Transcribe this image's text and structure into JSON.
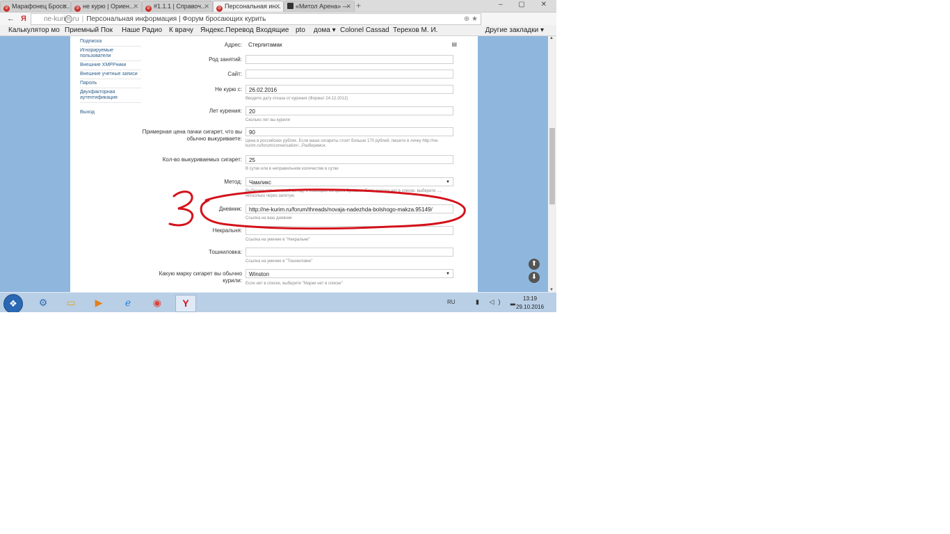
{
  "browser": {
    "tabs": [
      {
        "label": "Марафонец Бросо...",
        "active": false
      },
      {
        "label": "не курю | Ориен...",
        "active": false
      },
      {
        "label": "#1.1.1 | Справоч...",
        "active": false
      },
      {
        "label": "Персональная ин...",
        "active": true
      },
      {
        "label": "«Митол Арена» —",
        "active": false
      }
    ],
    "new_tab": "+",
    "window_controls": "– ▢ ✕",
    "url_host": "ne-kurim.ru",
    "url_title": "Персональная информация | Форум бросающих курить",
    "bookmarks": [
      "Калькулятор мо",
      "Приемный Пок",
      "Наше Радио",
      "К врачу",
      "Яндекс.Перевод",
      "Входящие",
      "pto",
      "дома ▾",
      "Colonel Cassad",
      "Терехов М. И."
    ],
    "other_bookmarks": "Другие закладки ▾"
  },
  "sidebar": {
    "items": [
      "Подписка",
      "Игнорируемые пользователи",
      "Внешние XMPPники",
      "Внешние учетные записи",
      "Пароль",
      "Двухфакторная аутентификация"
    ],
    "logout": "Выход"
  },
  "form": {
    "address": {
      "label": "Адрес:",
      "value": "Стерлитамак"
    },
    "occupation": {
      "label": "Род занятий:",
      "value": ""
    },
    "website": {
      "label": "Сайт:",
      "value": ""
    },
    "quit_date": {
      "label": "Не курю с:",
      "value": "26.02.2016",
      "hint": "Вводите дату отказа от курения (Формат 24.12.2012)"
    },
    "years_smoked": {
      "label": "Лет курения:",
      "value": "20",
      "hint": "Сколько лет вы курили"
    },
    "pack_price": {
      "label": "Примерная цена пачки сигарет, что вы обычно выкуриваете:",
      "value": "90",
      "hint": "Цена в российских рублях. Если ваше сигареты стоят больше 170 рублей, пишите в личку http://ne-kurim.ru/forum/conversation/...Разберемся."
    },
    "cigs_per_day": {
      "label": "Кол-во выкуриваемых сигарет:",
      "value": "25",
      "hint": "В сутки или в неправильном количестве в сутки"
    },
    "method": {
      "label": "Метод:",
      "value": "Чамликс",
      "hint": "Выберите тот или иной метод, с помощью которого бросили. Если метода нет в списке, выберите ..., несколько через запятую"
    },
    "diary": {
      "label": "Дневник:",
      "value": "http://ne-kurim.ru/forum/threads/novaja-nadezhda-bolshogo-makza.95149/",
      "hint": "Ссылка на ваш дневник"
    },
    "nekralny": {
      "label": "Некральня:",
      "value": "",
      "hint": "Ссылка на умение в \"Некральне\""
    },
    "toshnilovka": {
      "label": "Тошниловка:",
      "value": "",
      "hint": "Ссылка на умение в \"Тошниловке\""
    },
    "brand": {
      "label": "Какую марку сигарет вы обычно курили:",
      "value": "Winston",
      "hint": "Если нет в списке, выберите \"Марки нет в списке\""
    }
  },
  "annotation": {
    "number": "3",
    "color": "#d3121b"
  },
  "taskbar": {
    "lang": "RU",
    "tray": "▮ ◁) ▂",
    "time": "13:19",
    "date": "29.10.2016"
  }
}
